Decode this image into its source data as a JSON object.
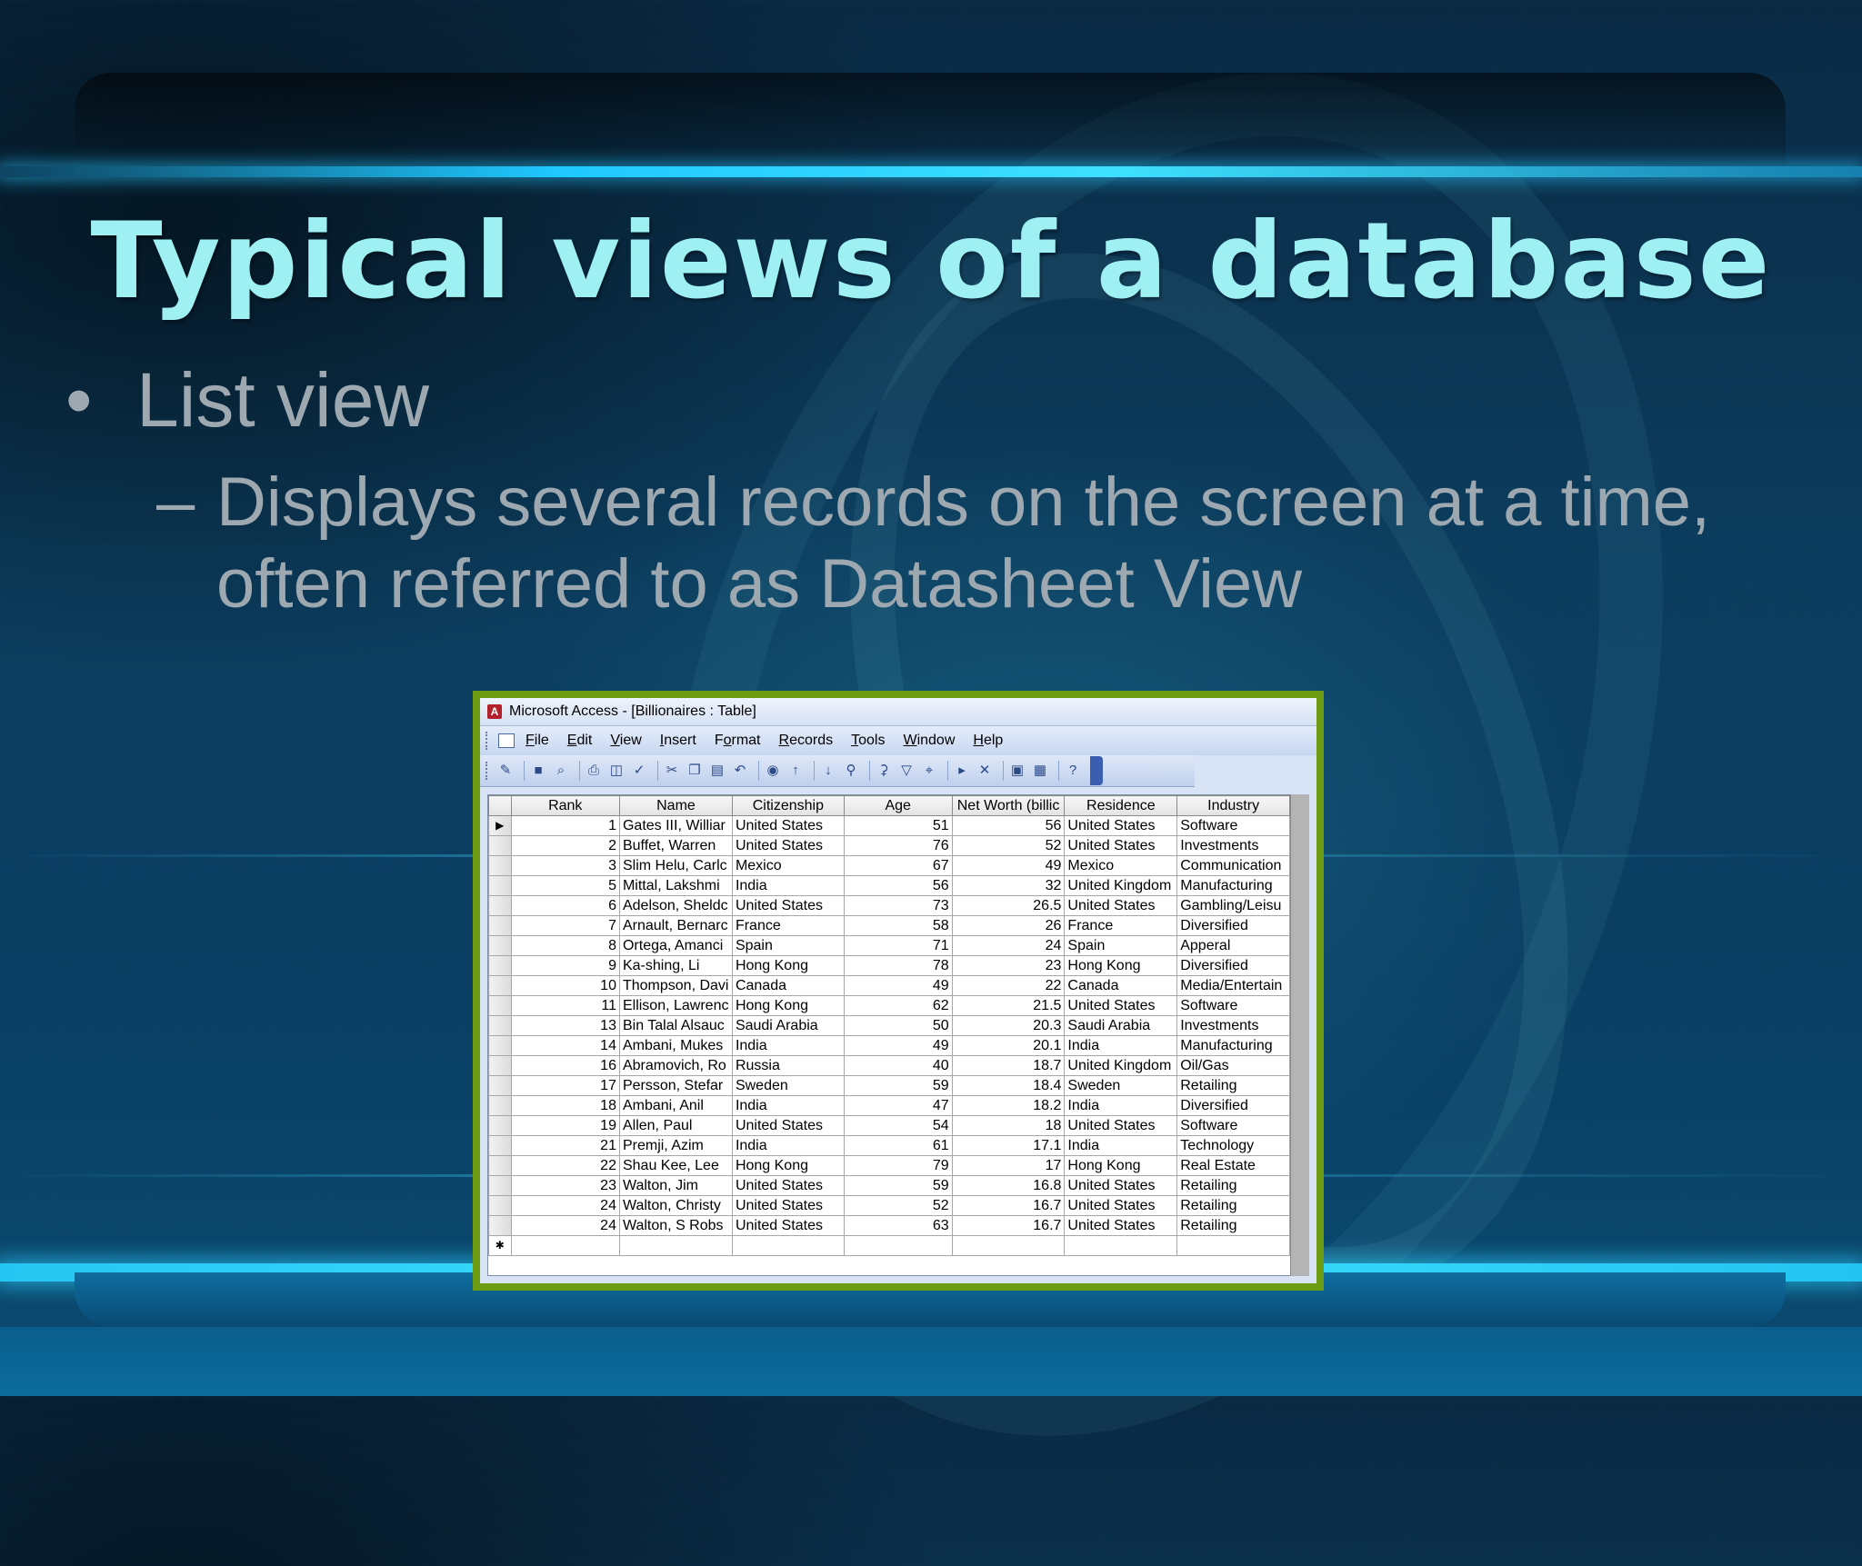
{
  "slide": {
    "title": "Typical views of a database",
    "bullet_1": "List view",
    "bullet_1_glyph": "•",
    "bullet_2_dash": "–",
    "bullet_2": "Displays several records on the screen at a time, often referred to as Datasheet View"
  },
  "access": {
    "window_title": "Microsoft Access - [Billionaires : Table]",
    "menu": [
      {
        "label": "File",
        "key": "F",
        "rest": "ile"
      },
      {
        "label": "Edit",
        "key": "E",
        "rest": "dit"
      },
      {
        "label": "View",
        "key": "V",
        "rest": "iew"
      },
      {
        "label": "Insert",
        "key": "I",
        "rest": "nsert"
      },
      {
        "label": "Format",
        "key": "o",
        "pre": "F",
        "rest": "rmat"
      },
      {
        "label": "Records",
        "key": "R",
        "rest": "ecords"
      },
      {
        "label": "Tools",
        "key": "T",
        "rest": "ools"
      },
      {
        "label": "Window",
        "key": "W",
        "rest": "indow"
      },
      {
        "label": "Help",
        "key": "H",
        "rest": "elp"
      }
    ],
    "toolbar_icons": [
      "design-view-icon",
      "save-icon",
      "search-icon",
      "print-icon",
      "print-preview-icon",
      "spelling-icon",
      "cut-icon",
      "copy-icon",
      "paste-icon",
      "undo-icon",
      "hyperlink-icon",
      "sort-ascending-icon",
      "sort-descending-icon",
      "filter-by-selection-icon",
      "filter-by-form-icon",
      "apply-filter-icon",
      "find-icon",
      "new-record-icon",
      "delete-record-icon",
      "database-window-icon",
      "new-object-icon",
      "help-icon"
    ],
    "columns": [
      "Rank",
      "Name",
      "Citizenship",
      "Age",
      "Net Worth (billic",
      "Residence",
      "Industry"
    ],
    "rows": [
      [
        "1",
        "Gates III, Williar",
        "United States",
        "51",
        "56",
        "United States",
        "Software"
      ],
      [
        "2",
        "Buffet, Warren",
        "United States",
        "76",
        "52",
        "United States",
        "Investments"
      ],
      [
        "3",
        "Slim Helu, Carlc",
        "Mexico",
        "67",
        "49",
        "Mexico",
        "Communication"
      ],
      [
        "5",
        "Mittal, Lakshmi",
        "India",
        "56",
        "32",
        "United Kingdom",
        "Manufacturing"
      ],
      [
        "6",
        "Adelson, Sheldc",
        "United States",
        "73",
        "26.5",
        "United States",
        "Gambling/Leisu"
      ],
      [
        "7",
        "Arnault, Bernarc",
        "France",
        "58",
        "26",
        "France",
        "Diversified"
      ],
      [
        "8",
        "Ortega, Amanci",
        "Spain",
        "71",
        "24",
        "Spain",
        "Apperal"
      ],
      [
        "9",
        "Ka-shing, Li",
        "Hong Kong",
        "78",
        "23",
        "Hong Kong",
        "Diversified"
      ],
      [
        "10",
        "Thompson, Davi",
        "Canada",
        "49",
        "22",
        "Canada",
        "Media/Entertain"
      ],
      [
        "11",
        "Ellison, Lawrenc",
        "Hong Kong",
        "62",
        "21.5",
        "United States",
        "Software"
      ],
      [
        "13",
        "Bin Talal Alsauc",
        "Saudi Arabia",
        "50",
        "20.3",
        "Saudi Arabia",
        "Investments"
      ],
      [
        "14",
        "Ambani, Mukes",
        "India",
        "49",
        "20.1",
        "India",
        "Manufacturing"
      ],
      [
        "16",
        "Abramovich, Ro",
        "Russia",
        "40",
        "18.7",
        "United Kingdom",
        "Oil/Gas"
      ],
      [
        "17",
        "Persson, Stefar",
        "Sweden",
        "59",
        "18.4",
        "Sweden",
        "Retailing"
      ],
      [
        "18",
        "Ambani, Anil",
        "India",
        "47",
        "18.2",
        "India",
        "Diversified"
      ],
      [
        "19",
        "Allen, Paul",
        "United States",
        "54",
        "18",
        "United States",
        "Software"
      ],
      [
        "21",
        "Premji, Azim",
        "India",
        "61",
        "17.1",
        "India",
        "Technology"
      ],
      [
        "22",
        "Shau Kee, Lee",
        "Hong Kong",
        "79",
        "17",
        "Hong Kong",
        "Real Estate"
      ],
      [
        "23",
        "Walton, Jim",
        "United States",
        "59",
        "16.8",
        "United States",
        "Retailing"
      ],
      [
        "24",
        "Walton, Christy",
        "United States",
        "52",
        "16.7",
        "United States",
        "Retailing"
      ],
      [
        "24",
        "Walton, S Robs",
        "United States",
        "63",
        "16.7",
        "United States",
        "Retailing"
      ]
    ],
    "current_row_glyph": "▶",
    "new_row_glyph": "✱"
  },
  "colors": {
    "title": "#9ff0f2",
    "body_text": "#9ea8b0",
    "window_border": "#6d9b12"
  }
}
